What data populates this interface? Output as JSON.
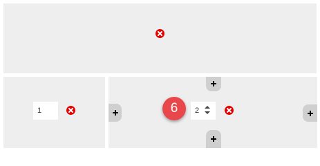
{
  "colors": {
    "panel_bg": "#eeeeee",
    "remove_red": "#e60000",
    "add_button_bg": "#cfcfcf",
    "badge_red": "#e8484c"
  },
  "left_panel": {
    "number_value": "1"
  },
  "right_panel": {
    "number_value": "2",
    "step_badge": "6"
  },
  "icons": {
    "remove": "remove-icon",
    "add": "plus-icon",
    "spinner": "spinner-arrows-icon"
  }
}
